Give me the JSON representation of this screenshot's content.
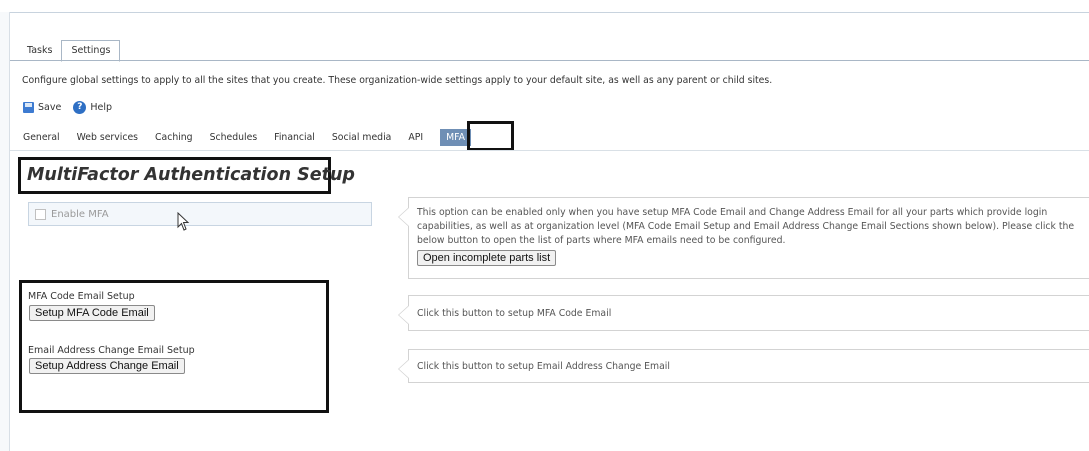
{
  "main_tabs": [
    {
      "label": "Tasks",
      "active": false
    },
    {
      "label": "Settings",
      "active": true
    }
  ],
  "description": "Configure global settings to apply to all the sites that you create. These organization-wide settings apply to your default site, as well as any parent or child sites.",
  "toolbar": {
    "save_label": "Save",
    "save_icon": "floppy-disk-icon",
    "help_label": "Help",
    "help_icon": "question-circle-icon",
    "help_glyph": "?"
  },
  "sub_tabs": [
    {
      "label": "General",
      "active": false
    },
    {
      "label": "Web services",
      "active": false
    },
    {
      "label": "Caching",
      "active": false
    },
    {
      "label": "Schedules",
      "active": false
    },
    {
      "label": "Financial",
      "active": false
    },
    {
      "label": "Social media",
      "active": false
    },
    {
      "label": "API",
      "active": false
    },
    {
      "label": "MFA",
      "active": true
    }
  ],
  "page_title": "MultiFactor Authentication Setup",
  "enable_mfa": {
    "label": "Enable MFA",
    "checked": false,
    "disabled": true
  },
  "mfa_info": {
    "text": "This option can be enabled only when you have setup MFA Code Email and Change Address Email for all your parts which provide login capabilities, as well as at organization level (MFA Code Email Setup and Email Address Change Email Sections shown below). Please click the below button to open the list of parts where MFA emails need to be configured.",
    "button_label": "Open incomplete parts list"
  },
  "mfa_code_email": {
    "section_label": "MFA Code Email Setup",
    "button_label": "Setup MFA Code Email",
    "hint": "Click this button to setup MFA Code Email"
  },
  "address_change_email": {
    "section_label": "Email Address Change Email Setup",
    "button_label": "Setup Address Change Email",
    "hint": "Click this button to setup Email Address Change Email"
  },
  "colors": {
    "active_subtab_bg": "#6f8fb5",
    "highlight_frame": "#111111",
    "tab_border": "#a9b7c6",
    "help_icon": "#2e6fc4",
    "save_icon": "#3d7bd1"
  }
}
